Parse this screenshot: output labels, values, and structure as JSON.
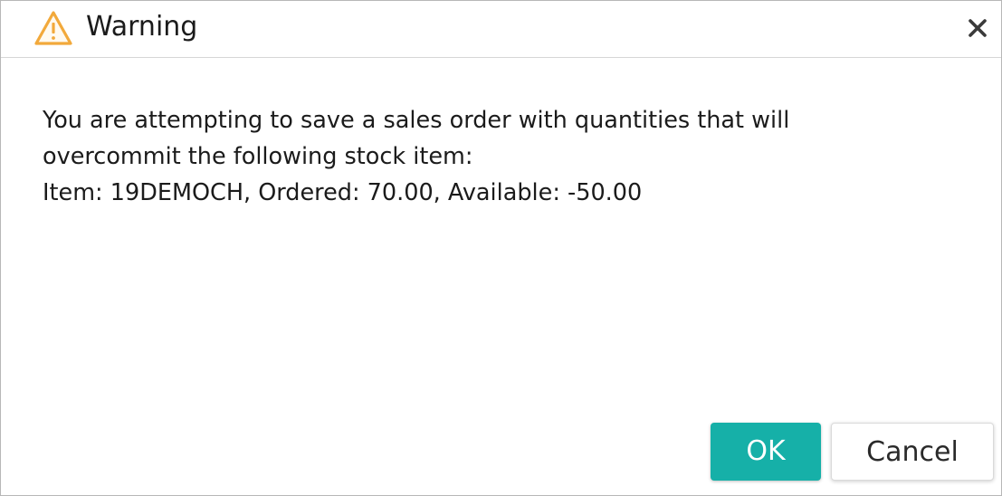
{
  "dialog": {
    "title": "Warning",
    "icon": "warning-triangle-icon",
    "close_icon": "close-icon",
    "message_lines": [
      "You are attempting to save a sales order with quantities that will",
      "overcommit the following stock item:",
      "Item: 19DEMOCH, Ordered: 70.00, Available: -50.00"
    ],
    "buttons": {
      "ok_label": "OK",
      "cancel_label": "Cancel"
    }
  },
  "colors": {
    "warning_icon": "#f2a93b",
    "ok_button_bg": "#16b0a8",
    "text": "#1b1b1b"
  }
}
